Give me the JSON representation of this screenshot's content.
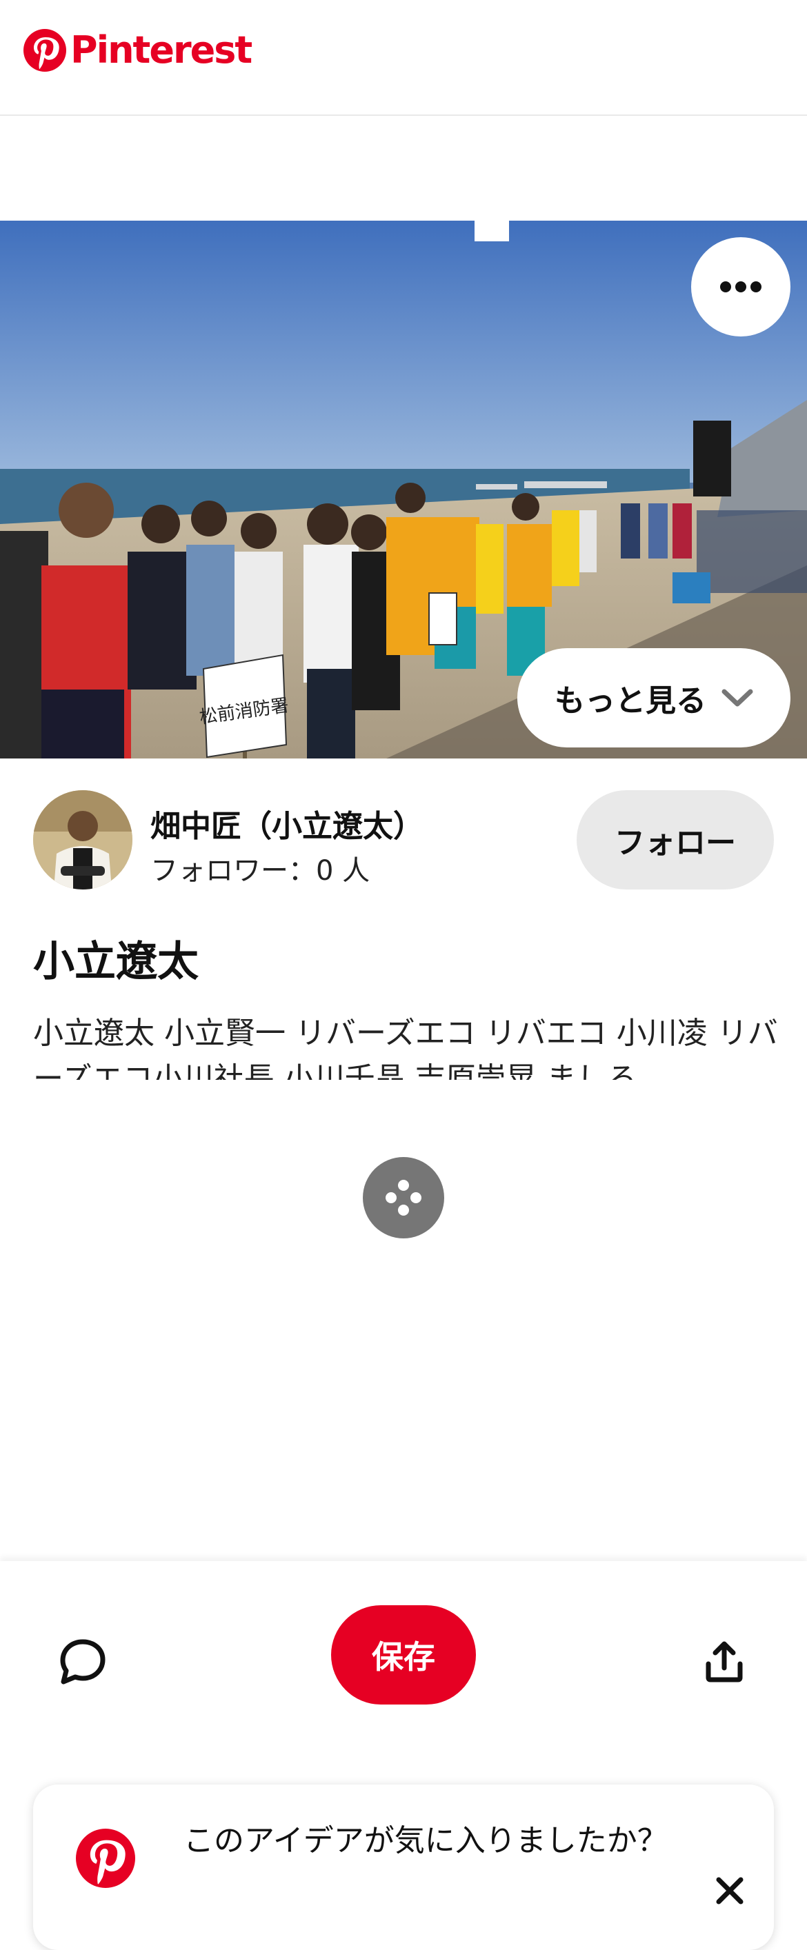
{
  "header": {
    "brand_name": "Pinterest"
  },
  "pin": {
    "more_options_icon": "ellipsis-icon",
    "see_more_label": "もっと見る",
    "creator": {
      "name": "畑中匠（小立遼太）",
      "followers": "フォロワー：0 人",
      "follow_label": "フォロー"
    },
    "title": "小立遼太",
    "description": "小立遼太 小立賢一 リバーズエコ リバエコ 小川凌 リバーズエコ小川社長 小川千晶 吉原崇晃 ましろ",
    "image_sign_text": "松前消防署"
  },
  "action_bar": {
    "comment_icon": "comment-icon",
    "save_label": "保存",
    "share_icon": "share-icon"
  },
  "prompt": {
    "text": "このアイデアが気に入りましたか？",
    "close_icon": "close-icon"
  },
  "colors": {
    "brand_red": "#e60023",
    "follow_bg": "#e9e9e9",
    "loader_bg": "#767676"
  }
}
